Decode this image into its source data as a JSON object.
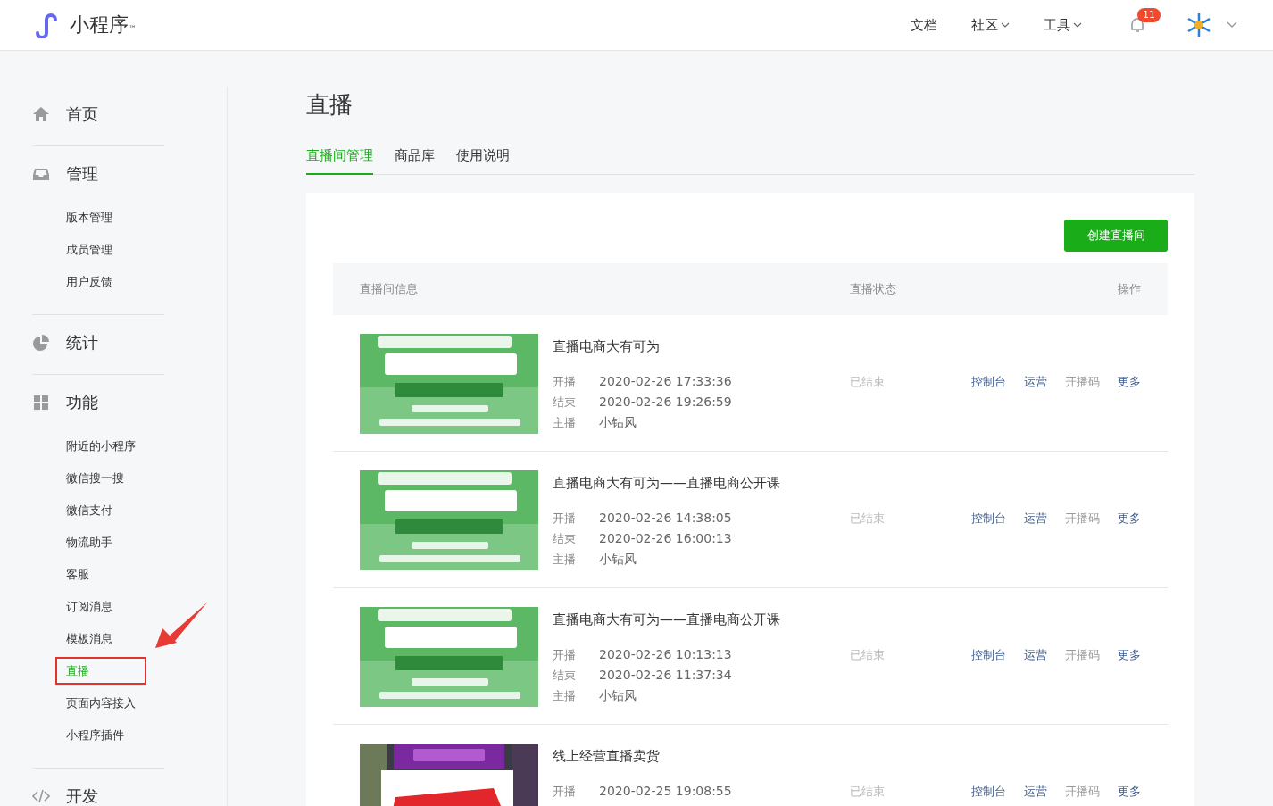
{
  "header": {
    "logo_text": "小程序",
    "logo_mark": "™",
    "nav": [
      {
        "label": "文档",
        "dropdown": false
      },
      {
        "label": "社区",
        "dropdown": true
      },
      {
        "label": "工具",
        "dropdown": true
      }
    ],
    "notification_count": "11"
  },
  "sidebar": {
    "sections": [
      {
        "label": "首页",
        "kind": "home"
      },
      {
        "label": "管理",
        "kind": "inbox",
        "children": [
          {
            "label": "版本管理",
            "selected": false,
            "annotated": false
          },
          {
            "label": "成员管理",
            "selected": false,
            "annotated": false
          },
          {
            "label": "用户反馈",
            "selected": false,
            "annotated": false
          }
        ]
      },
      {
        "label": "统计",
        "kind": "pie"
      },
      {
        "label": "功能",
        "kind": "grid",
        "children": [
          {
            "label": "附近的小程序",
            "selected": false,
            "annotated": false
          },
          {
            "label": "微信搜一搜",
            "selected": false,
            "annotated": false
          },
          {
            "label": "微信支付",
            "selected": false,
            "annotated": false
          },
          {
            "label": "物流助手",
            "selected": false,
            "annotated": false
          },
          {
            "label": "客服",
            "selected": false,
            "annotated": false
          },
          {
            "label": "订阅消息",
            "selected": false,
            "annotated": false
          },
          {
            "label": "模板消息",
            "selected": false,
            "annotated": false
          },
          {
            "label": "直播",
            "selected": true,
            "annotated": true
          },
          {
            "label": "页面内容接入",
            "selected": false,
            "annotated": false
          },
          {
            "label": "小程序插件",
            "selected": false,
            "annotated": false
          }
        ]
      },
      {
        "label": "开发",
        "kind": "code"
      }
    ]
  },
  "page_title": "直播",
  "tabs": [
    {
      "label": "直播间管理",
      "selected": true
    },
    {
      "label": "商品库",
      "selected": false
    },
    {
      "label": "使用说明",
      "selected": false
    }
  ],
  "create_button": "创建直播间",
  "table": {
    "columns": [
      "直播间信息",
      "直播状态",
      "操作"
    ],
    "rows": [
      {
        "title": "直播电商大有可为",
        "fields": [
          {
            "label": "开播",
            "value": "2020-02-26 17:33:36"
          },
          {
            "label": "结束",
            "value": "2020-02-26 19:26:59"
          },
          {
            "label": "主播",
            "value": "小钻风"
          }
        ],
        "status": "已结束",
        "actions": [
          {
            "label": "控制台",
            "disabled": false
          },
          {
            "label": "运营",
            "disabled": false
          },
          {
            "label": "开播码",
            "disabled": true
          },
          {
            "label": "更多",
            "disabled": false
          }
        ]
      },
      {
        "title": "直播电商大有可为——直播电商公开课",
        "fields": [
          {
            "label": "开播",
            "value": "2020-02-26 14:38:05"
          },
          {
            "label": "结束",
            "value": "2020-02-26 16:00:13"
          },
          {
            "label": "主播",
            "value": "小钻风"
          }
        ],
        "status": "已结束",
        "actions": [
          {
            "label": "控制台",
            "disabled": false
          },
          {
            "label": "运营",
            "disabled": false
          },
          {
            "label": "开播码",
            "disabled": true
          },
          {
            "label": "更多",
            "disabled": false
          }
        ]
      },
      {
        "title": "直播电商大有可为——直播电商公开课",
        "fields": [
          {
            "label": "开播",
            "value": "2020-02-26 10:13:13"
          },
          {
            "label": "结束",
            "value": "2020-02-26 11:37:34"
          },
          {
            "label": "主播",
            "value": "小钻风"
          }
        ],
        "status": "已结束",
        "actions": [
          {
            "label": "控制台",
            "disabled": false
          },
          {
            "label": "运营",
            "disabled": false
          },
          {
            "label": "开播码",
            "disabled": true
          },
          {
            "label": "更多",
            "disabled": false
          }
        ]
      },
      {
        "title": "线上经营直播卖货",
        "fields": [
          {
            "label": "开播",
            "value": "2020-02-25 19:08:55"
          }
        ],
        "status": "已结束",
        "actions": [
          {
            "label": "控制台",
            "disabled": false
          },
          {
            "label": "运营",
            "disabled": false
          },
          {
            "label": "开播码",
            "disabled": true
          },
          {
            "label": "更多",
            "disabled": false
          }
        ]
      }
    ]
  }
}
